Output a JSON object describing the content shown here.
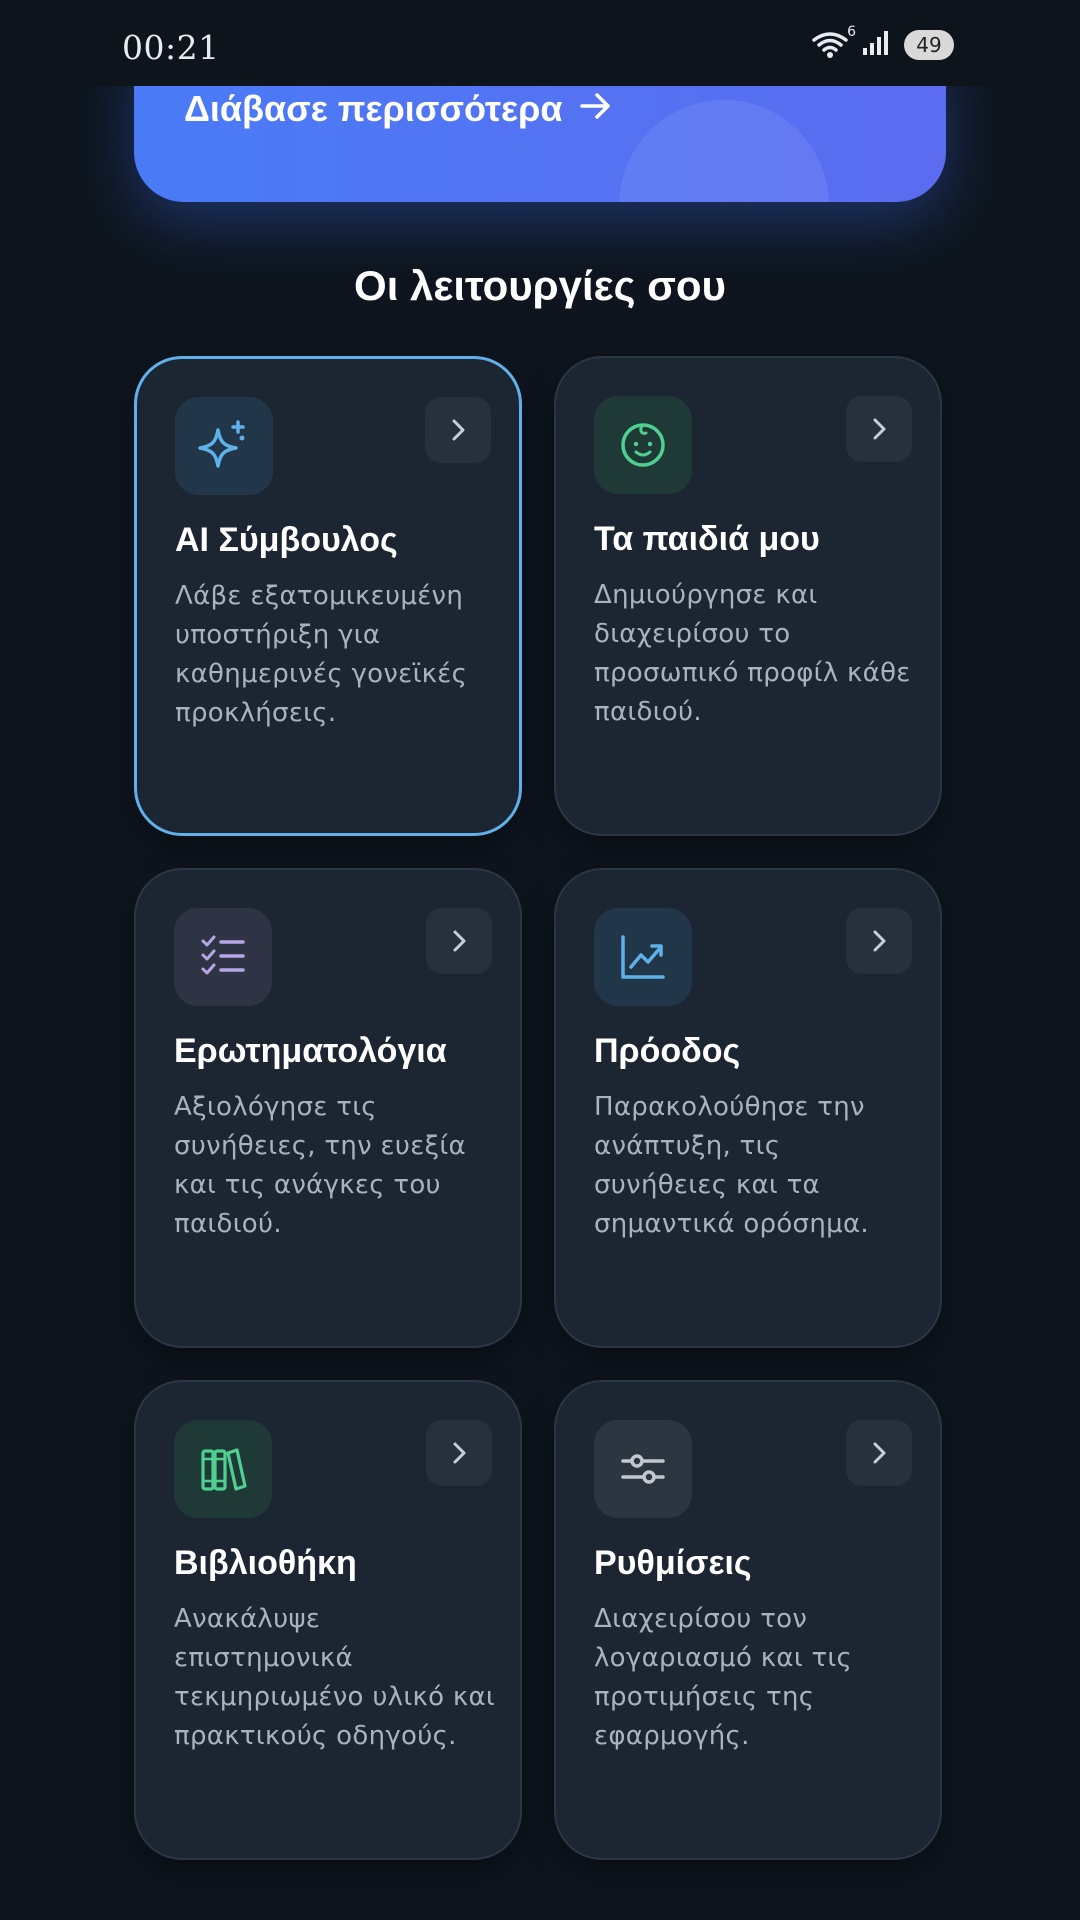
{
  "status_bar": {
    "time": "00:21",
    "network_badge": "6",
    "battery": "49",
    "icons": [
      "wifi-icon",
      "cellular-signal-icon",
      "battery-icon"
    ]
  },
  "hero": {
    "link_label": "Διάβασε περισσότερα",
    "link_icon": "arrow-right-icon"
  },
  "features": {
    "title": "Οι λειτουργίες σου",
    "cards": [
      {
        "title": "AI Σύμβουλος",
        "description": "Λάβε εξατομικευμένη υποστήριξη για καθημερινές γονεϊκές προκλήσεις.",
        "icon": "sparkles-icon",
        "icon_color": "#5fb1ea",
        "selected": true
      },
      {
        "title": "Τα παιδιά μου",
        "description": "Δημιούργησε και διαχειρίσου το προσωπικό προφίλ κάθε παιδιού.",
        "icon": "baby-face-icon",
        "icon_color": "#4fcf92",
        "selected": false
      },
      {
        "title": "Ερωτηματολόγια",
        "description": "Αξιολόγησε τις συνήθειες, την ευεξία και τις ανάγκες του παιδιού.",
        "icon": "checklist-icon",
        "icon_color": "#b6a6e6",
        "selected": false
      },
      {
        "title": "Πρόοδος",
        "description": "Παρακολούθησε την ανάπτυξη, τις συνήθειες και τα σημαντικά ορόσημα.",
        "icon": "trending-chart-icon",
        "icon_color": "#5fb1ea",
        "selected": false
      },
      {
        "title": "Βιβλιοθήκη",
        "description": "Ανακάλυψε επιστημονικά τεκμηριωμένο υλικό και πρακτικούς οδηγούς.",
        "icon": "books-icon",
        "icon_color": "#4fcf92",
        "selected": false
      },
      {
        "title": "Ρυθμίσεις",
        "description": "Διαχειρίσου τον λογαριασμό και τις προτιμήσεις της εφαρμογής.",
        "icon": "sliders-icon",
        "icon_color": "#c2c8d0",
        "selected": false
      }
    ],
    "chevron_icon": "chevron-right-icon"
  }
}
